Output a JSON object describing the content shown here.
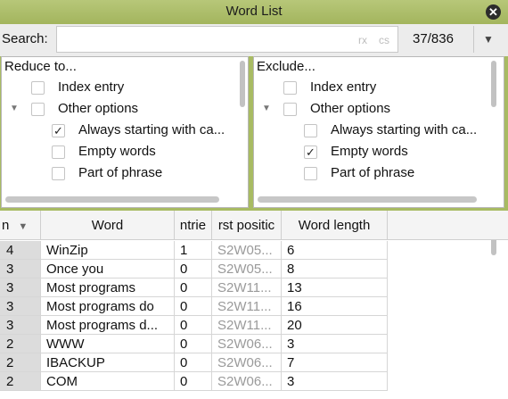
{
  "window": {
    "title": "Word List",
    "close_icon": "close-icon"
  },
  "search": {
    "label": "Search:",
    "value": "",
    "placeholder": "",
    "flag_rx": "rx",
    "flag_cs": "cs",
    "count": "37/836",
    "dropdown_icon": "chevron-down-icon"
  },
  "reduce": {
    "header": "Reduce to...",
    "items": [
      {
        "label": "Index entry",
        "checked": false,
        "expand": false
      },
      {
        "label": "Other options",
        "checked": false,
        "expand": true
      },
      {
        "label": "Always starting with ca...",
        "checked": true,
        "expand": false
      },
      {
        "label": "Empty words",
        "checked": false,
        "expand": false
      },
      {
        "label": "Part of phrase",
        "checked": false,
        "expand": false
      }
    ]
  },
  "exclude": {
    "header": "Exclude...",
    "items": [
      {
        "label": "Index entry",
        "checked": false,
        "expand": false
      },
      {
        "label": "Other options",
        "checked": false,
        "expand": true
      },
      {
        "label": "Always starting with ca...",
        "checked": false,
        "expand": false
      },
      {
        "label": "Empty words",
        "checked": true,
        "expand": false
      },
      {
        "label": "Part of phrase",
        "checked": false,
        "expand": false
      }
    ]
  },
  "table": {
    "columns": [
      "n",
      "Word",
      "ntrie",
      "rst positic",
      "Word length"
    ],
    "sort_icon": "sort-down-icon",
    "rows": [
      [
        "4",
        "WinZip",
        "1",
        "S2W05...",
        "6"
      ],
      [
        "3",
        "Once you",
        "0",
        "S2W05...",
        "8"
      ],
      [
        "3",
        "Most programs",
        "0",
        "S2W11...",
        "13"
      ],
      [
        "3",
        "Most programs do",
        "0",
        "S2W11...",
        "16"
      ],
      [
        "3",
        "Most programs d...",
        "0",
        "S2W11...",
        "20"
      ],
      [
        "2",
        "WWW",
        "0",
        "S2W06...",
        "3"
      ],
      [
        "2",
        "IBACKUP",
        "0",
        "S2W06...",
        "7"
      ],
      [
        "2",
        "COM",
        "0",
        "S2W06...",
        "3"
      ]
    ]
  }
}
